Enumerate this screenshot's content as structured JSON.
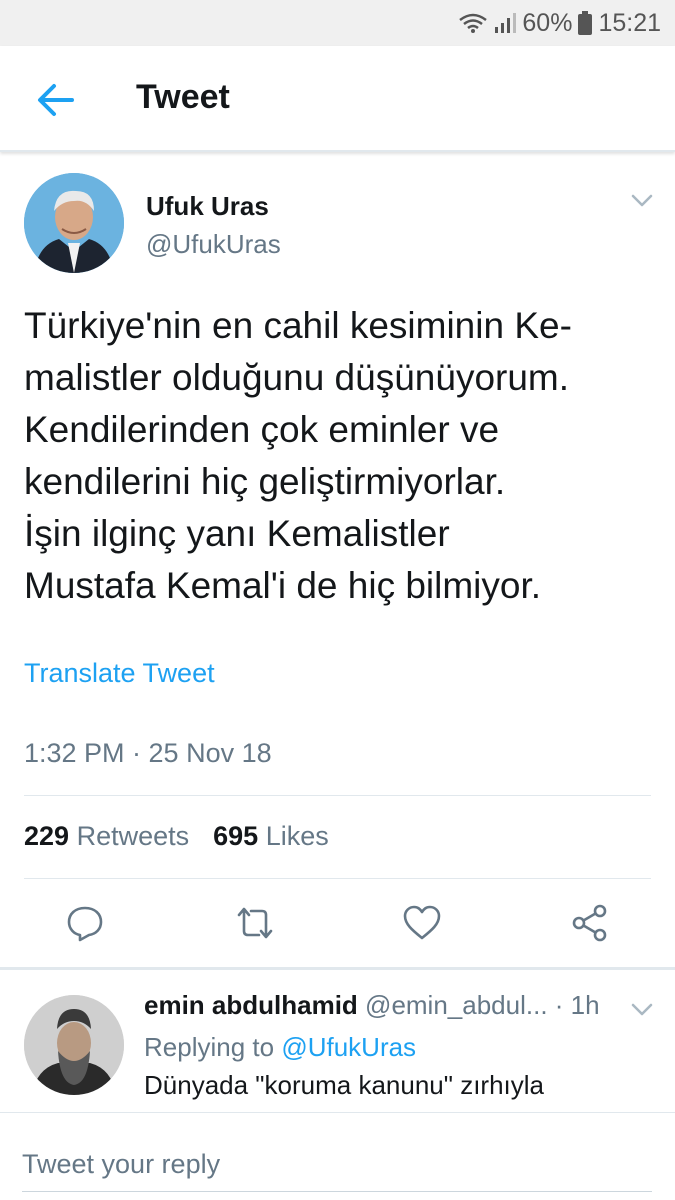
{
  "status_bar": {
    "battery": "60%",
    "time": "15:21"
  },
  "header": {
    "title": "Tweet",
    "back_icon": "arrow-left-icon"
  },
  "tweet": {
    "author_name": "Ufuk Uras",
    "author_handle": "@UfukUras",
    "text": "Türkiye'nin en cahil kesiminin Ke-\nmalistler olduğunu düşünüyorum.\nKendilerinden çok eminler ve\nkendilerini hiç geliştirmiyorlar.\nİşin ilginç yanı Kemalistler\nMustafa Kemal'i de hiç bilmiyor.",
    "translate_label": "Translate Tweet",
    "timestamp": "1:32 PM · 25 Nov 18",
    "retweets_count": "229",
    "retweets_label": "Retweets",
    "likes_count": "695",
    "likes_label": "Likes"
  },
  "actions": [
    "reply-icon",
    "retweet-icon",
    "like-icon",
    "share-icon"
  ],
  "reply": {
    "name": "emin abdulhamid",
    "handle": "@emin_abdul...",
    "time": "· 1h",
    "replying_prefix": "Replying to",
    "replying_to": "@UfukUras",
    "text": "Dünyada \"koruma kanunu\" zırhıyla"
  },
  "compose": {
    "placeholder": "Tweet your reply"
  },
  "colors": {
    "accent": "#1da1f2",
    "secondary_text": "#657786",
    "divider": "#e1e8ed"
  }
}
